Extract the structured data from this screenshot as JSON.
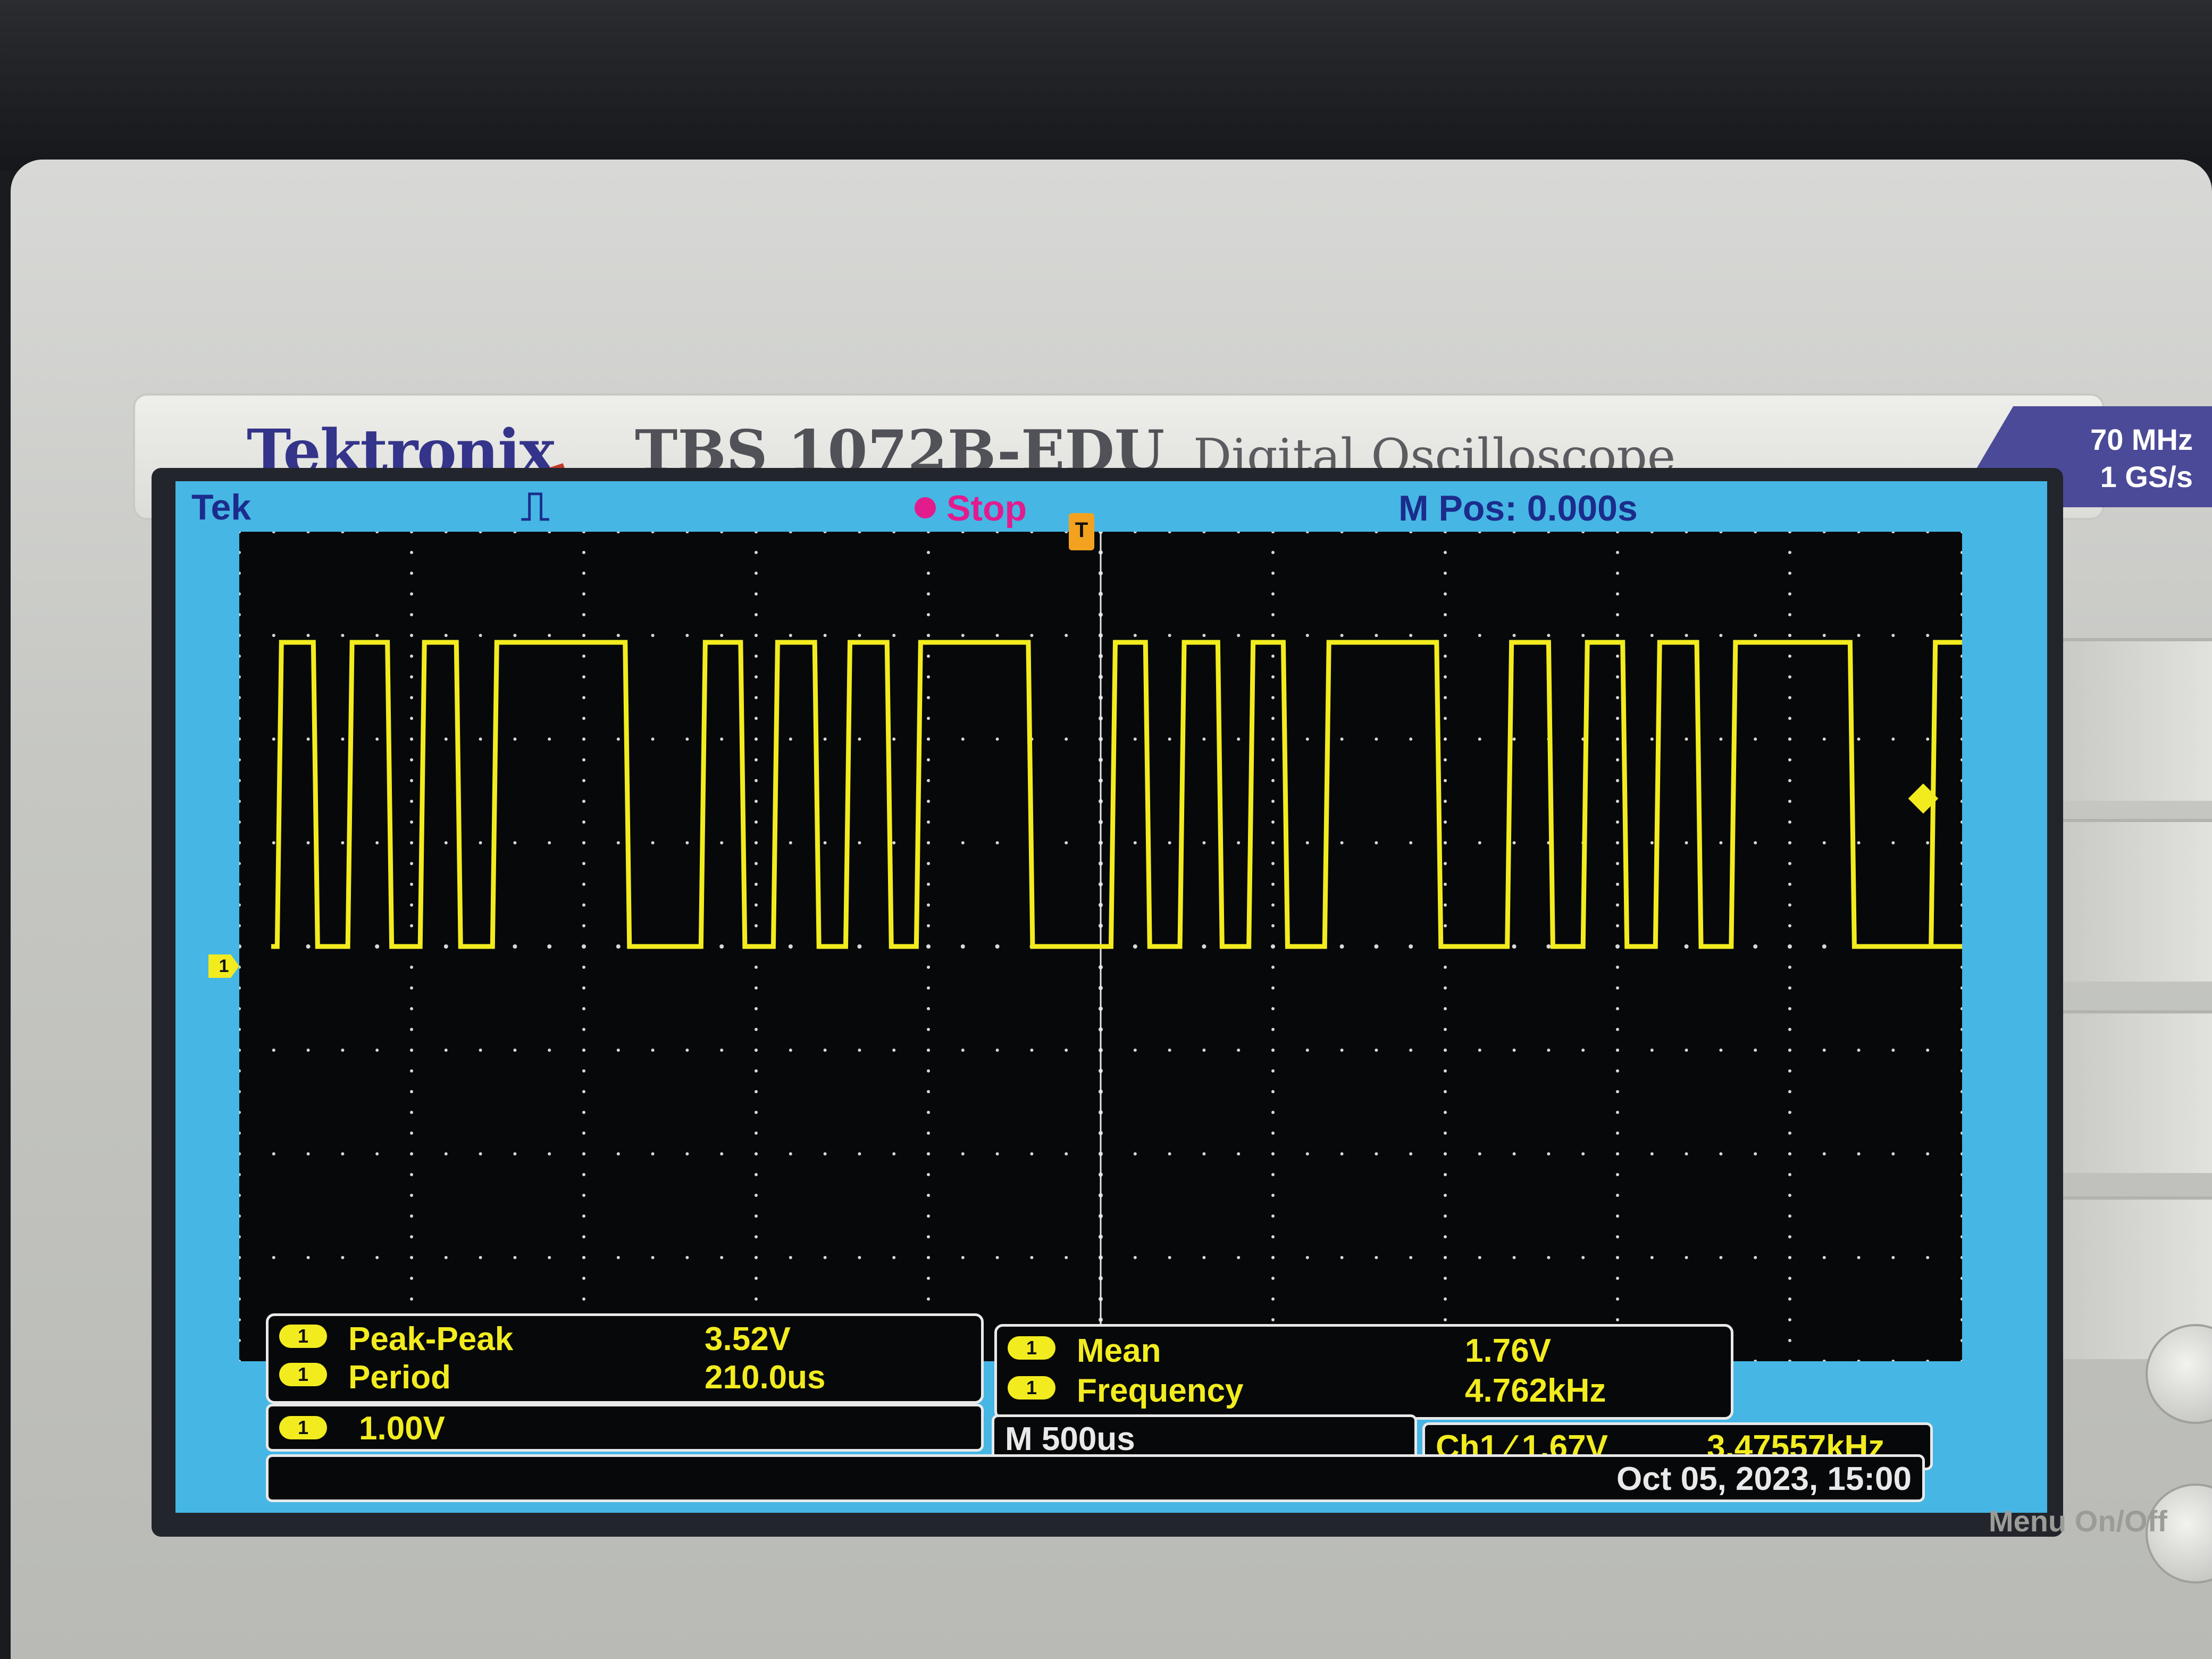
{
  "instrument": {
    "brand": "Tektronix",
    "model": "TBS 1072B-EDU",
    "description": "Digital Oscilloscope",
    "bandwidth": "70 MHz",
    "sample_rate": "1 GS/s"
  },
  "status_bar": {
    "logo": "Tek",
    "trigger_type_icon": "pulse-trigger-icon",
    "run_state": "Stop",
    "horizontal_position": "M Pos: 0.000s"
  },
  "markers": {
    "ch1_ground": "1",
    "trigger_position": "T"
  },
  "measurements": [
    {
      "channel": "1",
      "label": "Peak-Peak",
      "value": "3.52V"
    },
    {
      "channel": "1",
      "label": "Period",
      "value": "210.0us"
    },
    {
      "channel": "1",
      "label": "Mean",
      "value": "1.76V"
    },
    {
      "channel": "1",
      "label": "Frequency",
      "value": "4.762kHz"
    }
  ],
  "channel_scale": {
    "channel": "1",
    "volts_per_div": "1.00V"
  },
  "timebase": "M 500us",
  "trigger": {
    "source_slope_level": "Ch1 ⁄ 1.67V",
    "trigger_frequency": "3.47557kHz"
  },
  "datetime": "Oct 05, 2023, 15:00",
  "front_panel": {
    "menu_button_label": "Menu On/Off"
  },
  "colors": {
    "screen_frame": "#46b6e4",
    "trace_ch1": "#f2ec1f",
    "graticule_bg": "#07080a",
    "run_state": "#e21c8d",
    "brand": "#34348a"
  },
  "waveform": {
    "channel": "1",
    "low_level_div": 0,
    "high_level_div": 3.52,
    "high_intervals_div": [
      [
        0.22,
        0.43
      ],
      [
        0.63,
        0.86
      ],
      [
        1.05,
        1.26
      ],
      [
        1.47,
        2.24
      ],
      [
        2.68,
        2.91
      ],
      [
        3.1,
        3.34
      ],
      [
        3.52,
        3.76
      ],
      [
        3.93,
        4.58
      ],
      [
        5.06,
        5.26
      ],
      [
        5.46,
        5.68
      ],
      [
        5.86,
        6.06
      ],
      [
        6.3,
        6.95
      ],
      [
        7.36,
        7.6
      ],
      [
        7.8,
        8.03
      ],
      [
        8.22,
        8.46
      ],
      [
        8.66,
        9.35
      ],
      [
        9.82,
        10.05
      ]
    ]
  }
}
